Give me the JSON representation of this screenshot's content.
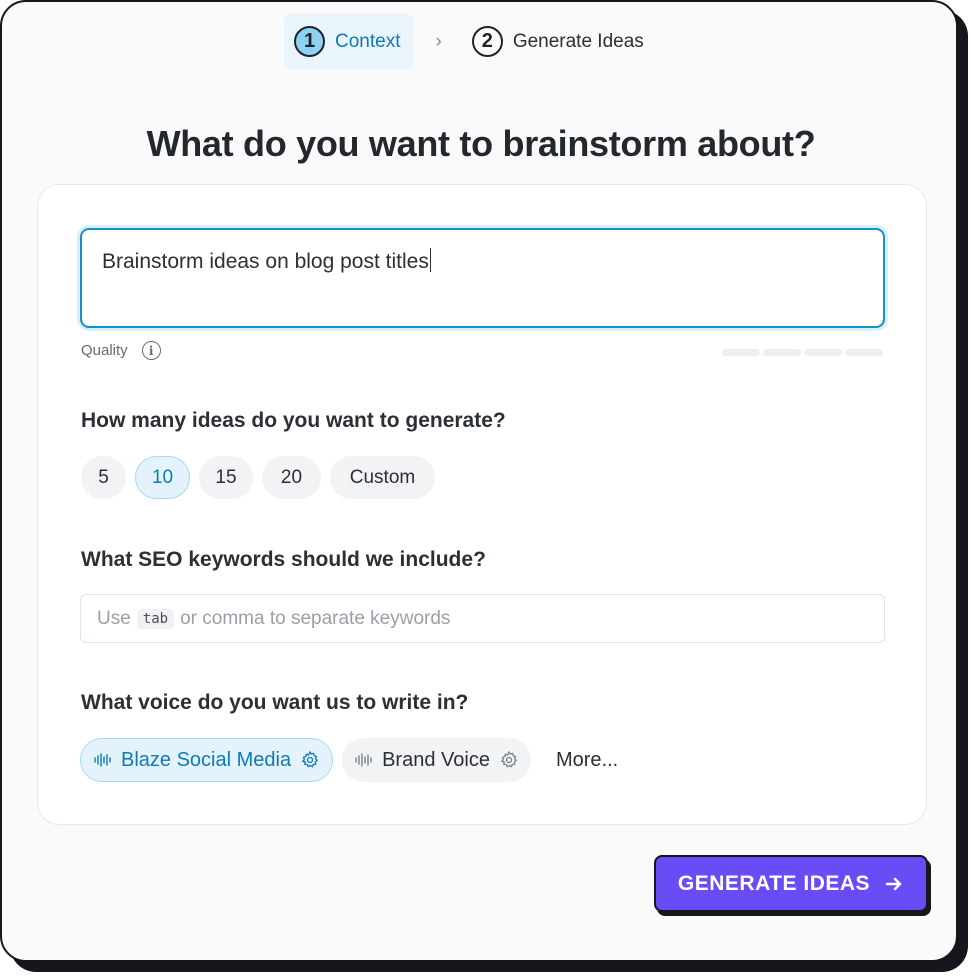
{
  "stepper": {
    "steps": [
      {
        "num": "1",
        "label": "Context",
        "active": true
      },
      {
        "num": "2",
        "label": "Generate Ideas",
        "active": false
      }
    ],
    "separator": "›"
  },
  "title": "What do you want to brainstorm about?",
  "prompt": {
    "value": "Brainstorm ideas on blog post titles"
  },
  "quality": {
    "label": "Quality",
    "info_icon": "info-icon",
    "level_fraction": 0
  },
  "ideas": {
    "heading": "How many ideas do you want to generate?",
    "options": [
      "5",
      "10",
      "15",
      "20",
      "Custom"
    ],
    "selected": "10"
  },
  "keywords": {
    "heading": "What SEO keywords should we include?",
    "placeholder_before": "Use",
    "placeholder_key": "tab",
    "placeholder_after": "or comma to separate keywords"
  },
  "voice": {
    "heading": "What voice do you want us to write in?",
    "options": [
      {
        "label": "Blaze Social Media",
        "selected": true
      },
      {
        "label": "Brand Voice",
        "selected": false
      }
    ],
    "more_label": "More..."
  },
  "generate_button": {
    "label": "GENERATE IDEAS",
    "icon": "arrow-right-icon"
  },
  "colors": {
    "accent": "#0d7bb8",
    "button": "#6a4cf7",
    "focus": "#1790c9"
  }
}
